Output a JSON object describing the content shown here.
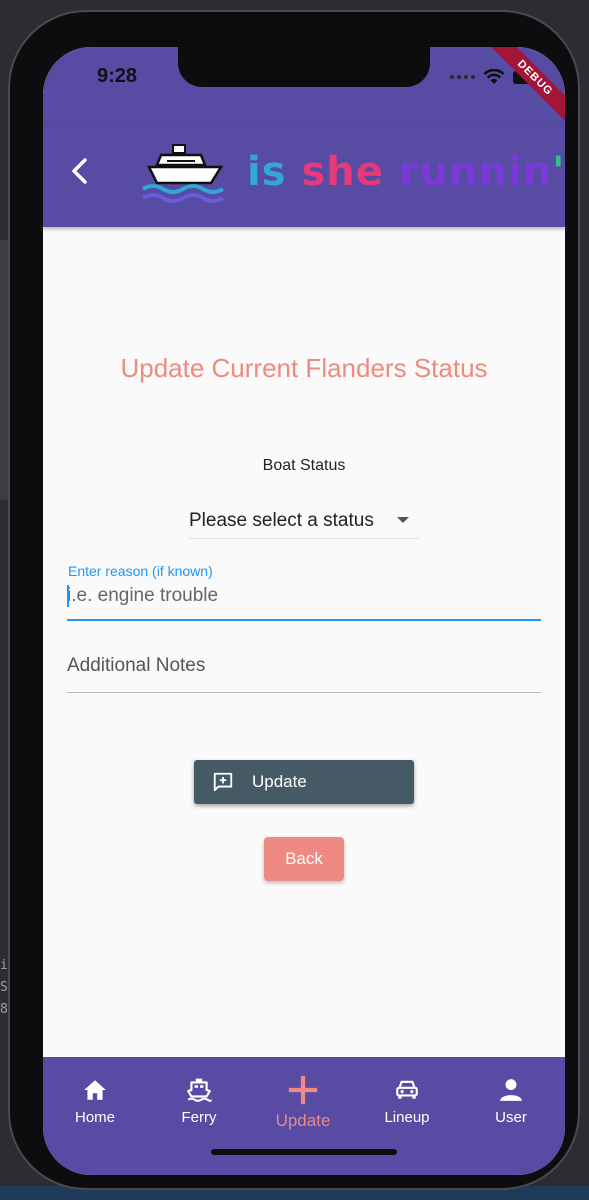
{
  "status_bar": {
    "time": "9:28"
  },
  "debug_banner": "DEBUG",
  "app_bar": {
    "logo_text_parts": [
      "is ",
      "she ",
      "runnin",
      "'",
      "?"
    ]
  },
  "page": {
    "title": "Update Current Flanders Status",
    "boat_status_label": "Boat Status",
    "status_dropdown": {
      "selected": "Please select a status"
    },
    "reason_field": {
      "label": "Enter reason (if known)",
      "placeholder": "i.e. engine trouble",
      "value": ""
    },
    "notes_field": {
      "placeholder": "Additional Notes",
      "value": ""
    },
    "update_button": "Update",
    "back_button": "Back"
  },
  "bottom_nav": {
    "items": [
      {
        "label": "Home",
        "icon": "home-icon",
        "active": false
      },
      {
        "label": "Ferry",
        "icon": "ferry-icon",
        "active": false
      },
      {
        "label": "Update",
        "icon": "plus-icon",
        "active": true
      },
      {
        "label": "Lineup",
        "icon": "car-icon",
        "active": false
      },
      {
        "label": "User",
        "icon": "person-icon",
        "active": false
      }
    ]
  },
  "background": {
    "side_text": [
      "i",
      "",
      "S",
      "8"
    ]
  },
  "colors": {
    "primary": "#574ba3",
    "accent_salmon": "#ee8a82",
    "field_focus": "#2196f3",
    "button_dark": "#455a64"
  }
}
